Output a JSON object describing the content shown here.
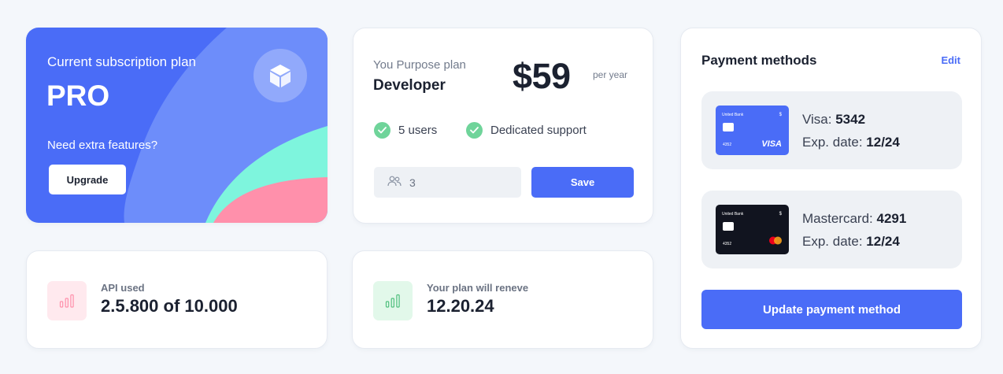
{
  "subscription": {
    "heading": "Current subscription plan",
    "plan": "PRO",
    "prompt": "Need extra features?",
    "upgrade_label": "Upgrade",
    "icon": "cube-icon"
  },
  "plan": {
    "purpose_label": "You Purpose plan",
    "name": "Developer",
    "price": "$59",
    "period": "per year",
    "features": [
      "5 users",
      "Dedicated support"
    ],
    "users_value": "3",
    "save_label": "Save"
  },
  "api": {
    "label": "API used",
    "value": "2.5.800 of 10.000",
    "icon": "bar-chart-icon"
  },
  "renewal": {
    "label": "Your plan will reneve",
    "value": "12.20.24",
    "icon": "bar-chart-icon"
  },
  "payment": {
    "title": "Payment methods",
    "edit_label": "Edit",
    "methods": [
      {
        "bank": "United Bank",
        "currency": "$",
        "card_last_digits": "4352",
        "brand_logo": "VISA",
        "type_label": "Visa:",
        "number": "5342",
        "exp_label": "Exp. date:",
        "exp": "12/24"
      },
      {
        "bank": "United Bank",
        "currency": "$",
        "card_last_digits": "4352",
        "brand_logo": "mastercard-logo",
        "type_label": "Mastercard:",
        "number": "4291",
        "exp_label": "Exp. date:",
        "exp": "12/24"
      }
    ],
    "update_label": "Update payment method"
  },
  "colors": {
    "accent": "#4a6cf7",
    "teal": "#7ef5dd",
    "pink": "#ff90ab",
    "success": "#6fd49a"
  }
}
